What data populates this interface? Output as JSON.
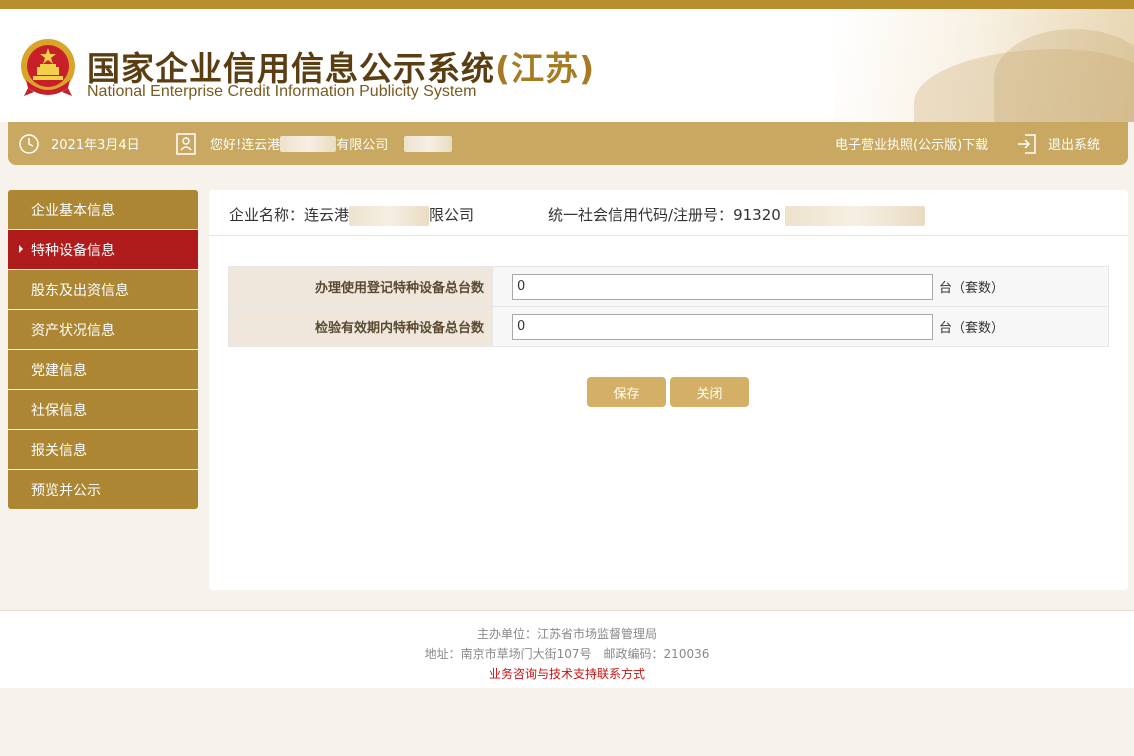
{
  "header": {
    "title_main": "国家企业信用信息公示系统",
    "title_province": "(江苏)",
    "subtitle": "National Enterprise Credit Information Publicity System",
    "emblem_icon": "national-emblem-icon"
  },
  "infobar": {
    "date": "2021年3月4日",
    "greeting_prefix": "您好!连云港",
    "greeting_suffix": "有限公司",
    "license_download": "电子营业执照(公示版)下载",
    "logout": "退出系统",
    "icons": {
      "clock": "clock-icon",
      "user": "user-card-icon",
      "logout": "logout-icon"
    }
  },
  "sidebar": {
    "items": [
      {
        "label": "企业基本信息",
        "active": false
      },
      {
        "label": "特种设备信息",
        "active": true
      },
      {
        "label": "股东及出资信息",
        "active": false
      },
      {
        "label": "资产状况信息",
        "active": false
      },
      {
        "label": "党建信息",
        "active": false
      },
      {
        "label": "社保信息",
        "active": false
      },
      {
        "label": "报关信息",
        "active": false
      },
      {
        "label": "预览并公示",
        "active": false
      }
    ]
  },
  "company": {
    "name_label": "企业名称：",
    "name_prefix": "连云港",
    "name_suffix": "限公司",
    "code_label": "统一社会信用代码/注册号：",
    "code_prefix": "91320"
  },
  "form": {
    "rows": [
      {
        "label": "办理使用登记特种设备总台数",
        "value": "0",
        "unit": "台（套数）"
      },
      {
        "label": "检验有效期内特种设备总台数",
        "value": "0",
        "unit": "台（套数）"
      }
    ],
    "save_label": "保存",
    "close_label": "关闭"
  },
  "footer": {
    "organizer": "主办单位：江苏省市场监督管理局",
    "address": "地址：南京市草场门大街107号　邮政编码：210036",
    "contact_link": "业务咨询与技术支持联系方式"
  },
  "colors": {
    "top_strip": "#b88f2e",
    "infobar": "#c9a862",
    "nav_item": "#ad8633",
    "nav_active": "#b01c1c",
    "button": "#d4b066",
    "footer_link": "#cc1111"
  }
}
